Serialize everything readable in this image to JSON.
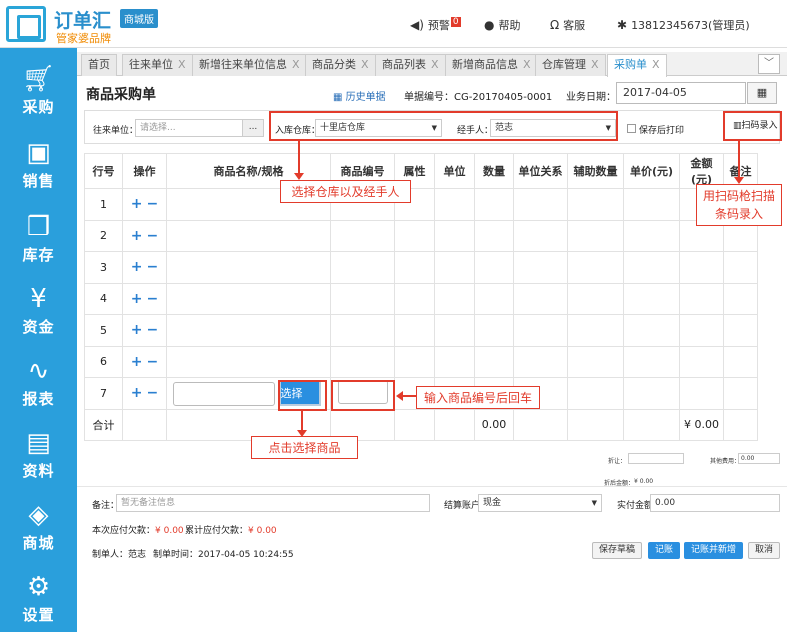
{
  "brand": {
    "title": "订单汇",
    "badge": "商城版",
    "subtitle": "管家婆品牌"
  },
  "topnav": {
    "alarm": "预警",
    "alarm_count": "0",
    "help": "帮助",
    "service": "客服",
    "user": "13812345673(管理员)"
  },
  "sidebar": {
    "items": [
      {
        "label": "采购",
        "icon": "cart-icon"
      },
      {
        "label": "销售",
        "icon": "sale-tag-icon"
      },
      {
        "label": "库存",
        "icon": "boxes-icon"
      },
      {
        "label": "资金",
        "icon": "money-bag-icon"
      },
      {
        "label": "报表",
        "icon": "chart-line-icon"
      },
      {
        "label": "资料",
        "icon": "id-card-icon"
      },
      {
        "label": "商城",
        "icon": "cube-icon"
      },
      {
        "label": "设置",
        "icon": "gear-icon"
      }
    ]
  },
  "tabs": [
    {
      "label": "首页"
    },
    {
      "label": "往来单位"
    },
    {
      "label": "新增往来单位信息"
    },
    {
      "label": "商品分类"
    },
    {
      "label": "商品列表"
    },
    {
      "label": "新增商品信息"
    },
    {
      "label": "仓库管理"
    },
    {
      "label": "采购单"
    }
  ],
  "tab_close": "X",
  "header": {
    "title": "商品采购单",
    "history": "历史单据",
    "doc_no": "单据编号：CG-20170405-0001",
    "bizdate_label": "业务日期：",
    "bizdate": "2017-04-05"
  },
  "filter": {
    "partner_label": "往来单位：",
    "partner_placeholder": "请选择...",
    "dots": "...",
    "warehouse_label": "入库仓库：",
    "warehouse": "十里店仓库",
    "handler_label": "经手人：",
    "handler": "范志",
    "print_after_save": "保存后打印",
    "scan": "扫码录入"
  },
  "table": {
    "headers": [
      "行号",
      "操作",
      "商品名称/规格",
      "商品编号",
      "属性",
      "单位",
      "数量",
      "单位关系",
      "辅助数量",
      "单价(元)",
      "金额(元)",
      "备注"
    ],
    "rows": [
      "1",
      "2",
      "3",
      "4",
      "5",
      "6",
      "7"
    ],
    "select_button": "选择",
    "total_label": "合计",
    "total_qty": "0.00",
    "total_amount": "¥ 0.00"
  },
  "summary": {
    "discount_label": "折让：",
    "other_label": "其他费用：",
    "other_value": "0.00",
    "after_label": "折后金额：",
    "after_value": "¥ 0.00"
  },
  "annotations": {
    "warehouse": "选择仓库以及经手人",
    "scan": "用扫码枪扫描条码录入",
    "code": "输入商品编号后回车",
    "select": "点击选择商品"
  },
  "bottom": {
    "remark_label": "备注：",
    "remark_placeholder": "暂无备注信息",
    "account_label": "结算账户",
    "account": "现金",
    "paid_label": "实付金额",
    "paid": "0.00",
    "payable_label": "本次应付欠款：",
    "payable": "¥ 0.00",
    "acc_payable_label": "累计应付欠款：",
    "acc_payable": "¥ 0.00",
    "maker": "制单人：范志",
    "make_time": "制单时间：2017-04-05 10:24:55",
    "save_draft": "保存草稿",
    "post": "记账",
    "post_new": "记账并新增",
    "cancel": "取消"
  }
}
